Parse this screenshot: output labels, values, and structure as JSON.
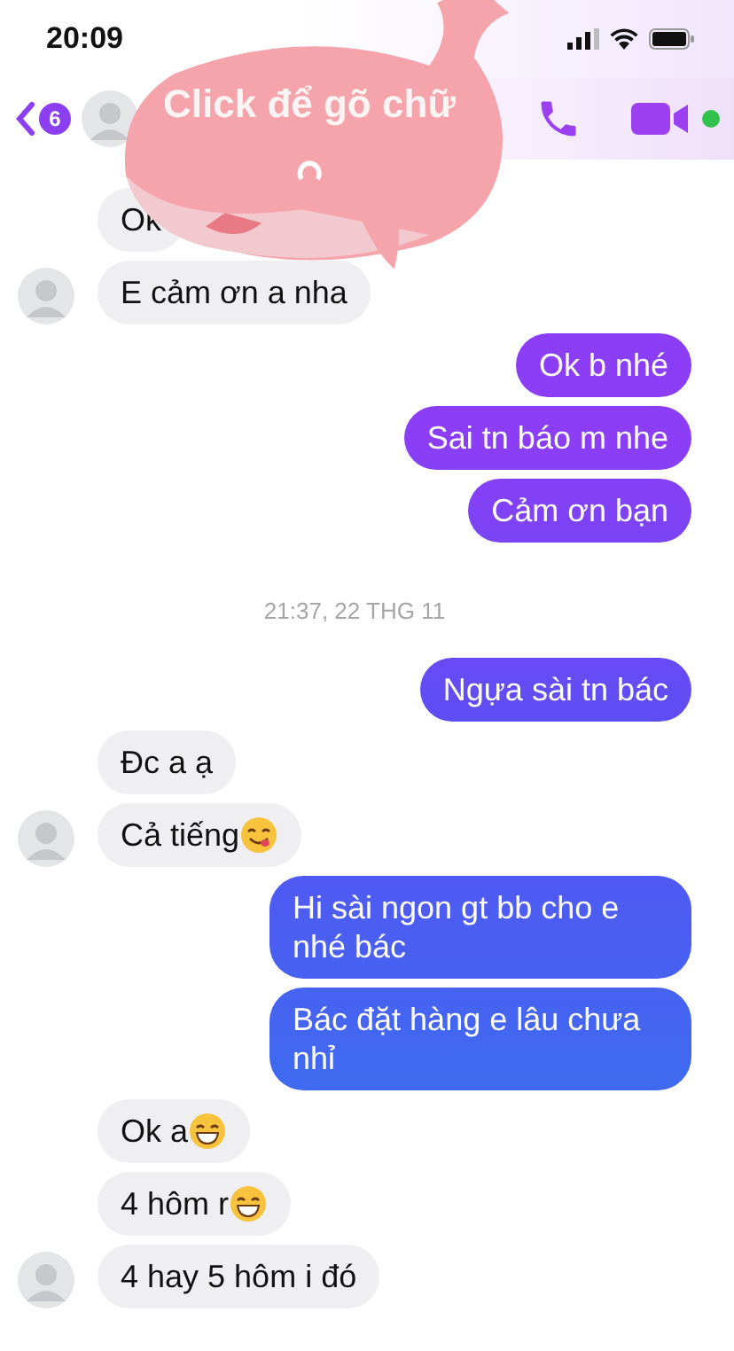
{
  "status_bar": {
    "time": "20:09"
  },
  "header": {
    "unread_badge": "6",
    "active": true
  },
  "sticker": {
    "text": "Click để gõ chữ"
  },
  "messages": [
    {
      "kind": "incoming",
      "text": "Ok",
      "avatar": false
    },
    {
      "kind": "incoming",
      "text": "E cảm ơn a nha",
      "avatar": true
    },
    {
      "kind": "outgoing",
      "text": "Ok b nhé"
    },
    {
      "kind": "outgoing",
      "text": "Sai tn báo m nhe"
    },
    {
      "kind": "outgoing",
      "text": "Cảm ơn bạn"
    },
    {
      "kind": "timestamp",
      "text": "21:37, 22 THG 11"
    },
    {
      "kind": "outgoing",
      "text": "Ngựa sài tn bác"
    },
    {
      "kind": "incoming",
      "text": "Đc a ạ",
      "avatar": false
    },
    {
      "kind": "incoming",
      "text": "Cả tiếng",
      "emoji": {
        "kind": "yum"
      },
      "avatar": true
    },
    {
      "kind": "outgoing",
      "text": "Hi sài ngon gt bb cho e nhé bác"
    },
    {
      "kind": "outgoing",
      "text": "Bác đặt hàng e lâu chưa nhỉ"
    },
    {
      "kind": "incoming",
      "text": "Ok a",
      "emoji": {
        "kind": "grin"
      },
      "avatar": false
    },
    {
      "kind": "incoming",
      "text": "4 hôm r",
      "emoji": {
        "kind": "grin"
      },
      "avatar": false
    },
    {
      "kind": "incoming",
      "text": "4 hay 5 hôm i đó",
      "avatar": true
    }
  ]
}
